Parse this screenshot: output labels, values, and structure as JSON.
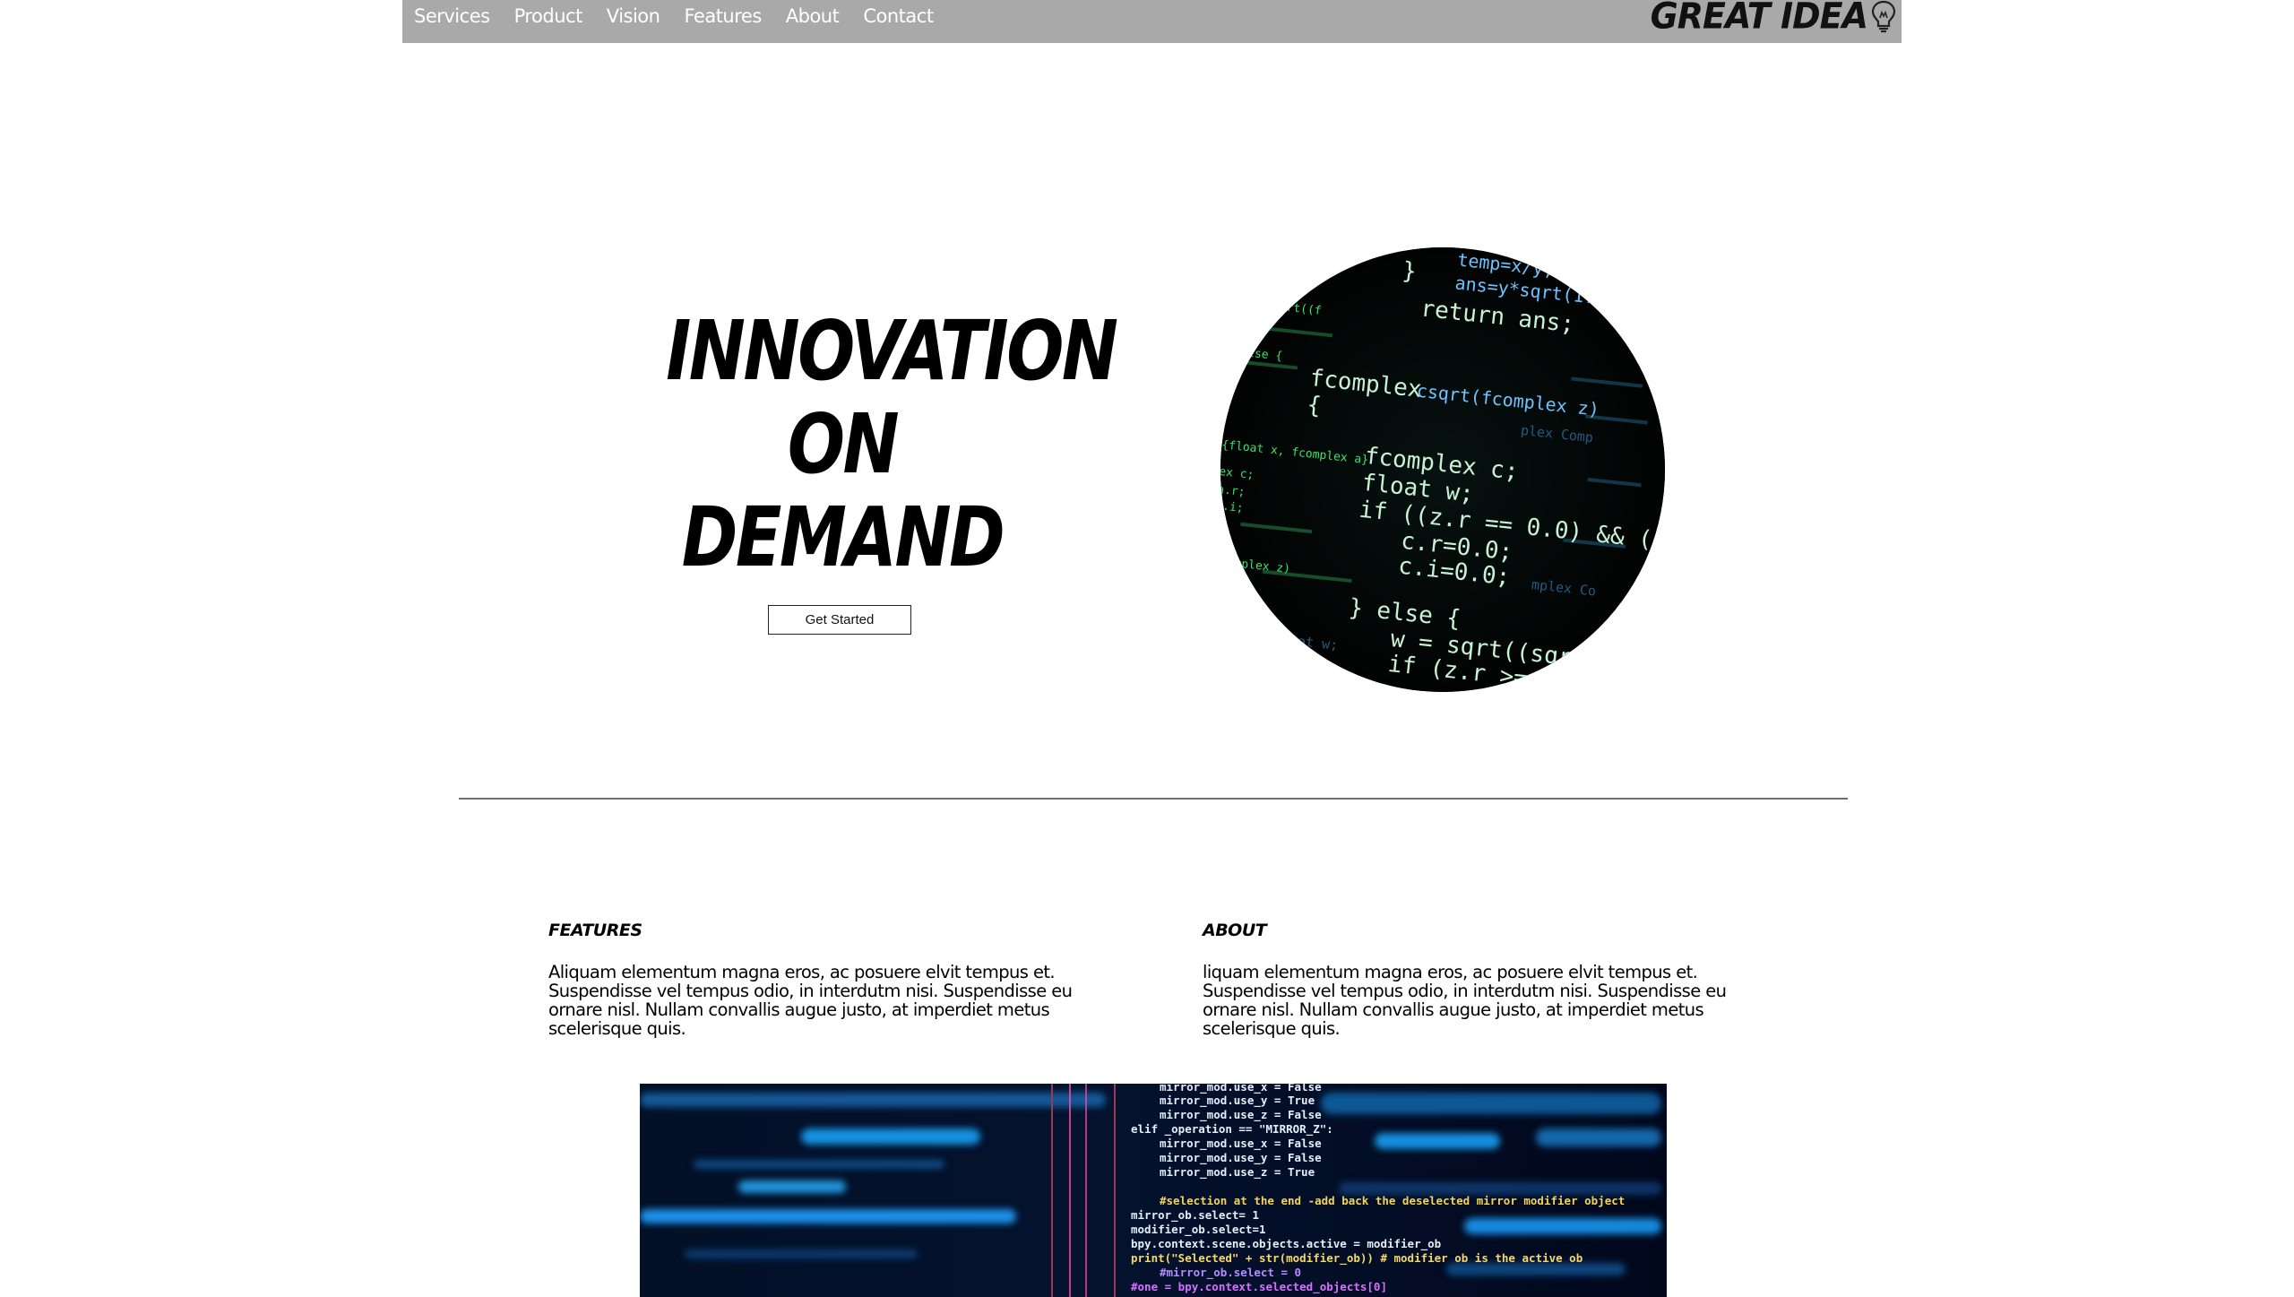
{
  "nav": {
    "links": [
      "Services",
      "Product",
      "Vision",
      "Features",
      "About",
      "Contact"
    ],
    "brand": "GREAT IDEA"
  },
  "hero": {
    "title_lines": [
      "INNOVATION",
      "ON",
      "DEMAND"
    ],
    "cta_label": "Get Started"
  },
  "sections": {
    "features": {
      "heading": "FEATURES",
      "body": "Aliquam elementum magna eros, ac posuere elvit tempus et. Suspendisse vel tempus odio, in interdutm nisi. Suspendisse eu ornare nisl. Nullam convallis augue justo, at imperdiet metus scelerisque quis."
    },
    "about": {
      "heading": "ABOUT",
      "body": "liquam elementum magna eros, ac posuere elvit tempus et. Suspendisse vel tempus odio, in interdutm nisi. Suspendisse eu ornare nisl. Nullam convallis augue justo, at imperdiet metus scelerisque quis."
    }
  },
  "icons": {
    "brand_logo": "lightbulb-icon"
  },
  "colors": {
    "navbar_bg": "#a9a9a9",
    "nav_text": "#ffffff",
    "code_green": "#39e06a",
    "code_blue": "#4fb6ff"
  }
}
